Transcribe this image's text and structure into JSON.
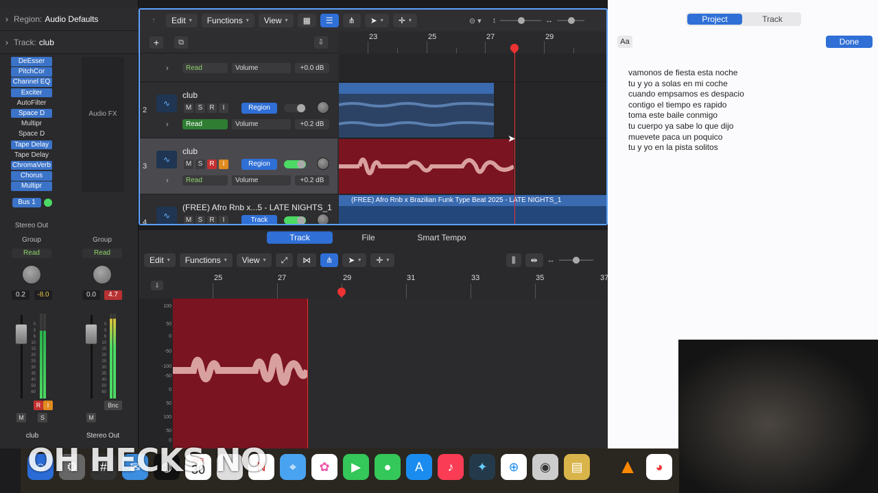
{
  "inspector": {
    "region_key": "Region:",
    "region_value": "Audio Defaults",
    "track_key": "Track:",
    "track_value": "club",
    "plugins": [
      "DeEsser",
      "PitchCor",
      "Channel EQ",
      "Exciter",
      "AutoFilter",
      "Space D",
      "Multipr",
      "Space D",
      "Tape Delay",
      "Tape Delay",
      "ChromaVerb",
      "Chorus",
      "Multipr"
    ],
    "audio_fx_label": "Audio FX",
    "bus_label": "Bus 1",
    "stereo_out": "Stereo Out",
    "group_label": "Group",
    "read_label": "Read",
    "strip1": {
      "pan": "0.2",
      "peak": "-8.0",
      "name": "club",
      "m": "M",
      "s": "S",
      "r": "R",
      "i": "I"
    },
    "strip2": {
      "pan": "0.0",
      "peak": "4.7",
      "name": "Stereo Out",
      "m": "M",
      "bnc": "Bnc"
    },
    "fader_scale": [
      "0",
      "3",
      "6",
      "10",
      "15",
      "20",
      "25",
      "30",
      "35",
      "40",
      "50",
      "60"
    ]
  },
  "main": {
    "toolbar": {
      "edit": "Edit",
      "functions": "Functions",
      "view": "View",
      "add": "+"
    },
    "ruler": [
      "23",
      "25",
      "27",
      "29"
    ],
    "tracks": [
      {
        "num": "",
        "name": "",
        "auto_mode": "Read",
        "auto_param": "Volume",
        "auto_db": "+0.0 dB"
      },
      {
        "num": "2",
        "name": "club",
        "region_btn": "Region",
        "auto_mode": "Read",
        "auto_param": "Volume",
        "auto_db": "+0.2 dB"
      },
      {
        "num": "3",
        "name": "club",
        "region_btn": "Region",
        "auto_mode": "Read",
        "auto_param": "Volume",
        "auto_db": "+0.2 dB"
      },
      {
        "num": "4",
        "name": "(FREE) Afro Rnb x...5 - LATE NIGHTS_1",
        "region_btn": "Track"
      }
    ],
    "track4_region": "(FREE) Afro Rnb x Brazilian Funk Type Beat 2025 - LATE NIGHTS_1",
    "btn_labels": {
      "m": "M",
      "s": "S",
      "r": "R",
      "i": "I"
    }
  },
  "editor": {
    "tabs": [
      "Track",
      "File",
      "Smart Tempo"
    ],
    "toolbar": {
      "edit": "Edit",
      "functions": "Functions",
      "view": "View"
    },
    "ruler": [
      "25",
      "27",
      "29",
      "31",
      "33",
      "35",
      "37"
    ],
    "amp_scale": [
      "100",
      "50",
      "0",
      "-50",
      "-100",
      "-50",
      "0",
      "50",
      "100",
      "50",
      "0",
      "-50",
      "-100"
    ]
  },
  "right": {
    "tabs": [
      "Project",
      "Track"
    ],
    "aa": "Aa",
    "done": "Done",
    "lyrics": "vamonos de fiesta esta noche\ntu y yo a solas en mi coche\ncuando empsamos es despacio\ncontigo el tiempo es rapido\ntoma este baile conmigo\ntu cuerpo ya sabe lo que dijo\nmuevete paca un poquico\ntu y yo en la pista solitos"
  },
  "dock": {
    "calendar_month": "APR",
    "calendar_day": "30",
    "overlay": "OH HECKS NO"
  },
  "colors": {
    "accent": "#2f6fd6",
    "region_red": "#7a1420",
    "region_blue": "#3a6ab0",
    "playhead": "#e33333",
    "read_green": "#8fd36b"
  }
}
